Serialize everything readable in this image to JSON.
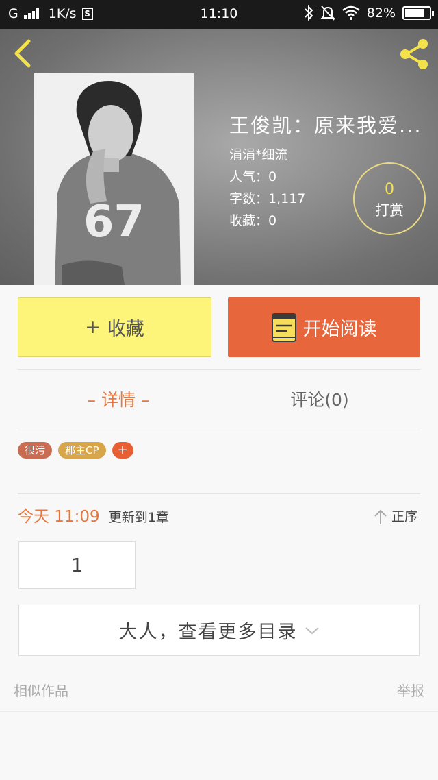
{
  "status_bar": {
    "network": "G",
    "speed": "1K/s",
    "s_label": "S",
    "time": "11:10",
    "battery": "82%",
    "battery_level": 0.82
  },
  "book": {
    "title": "王俊凯：原来我爱...",
    "author": "涓涓*细流",
    "popularity": "人气：0",
    "word_count": "字数：1,117",
    "favorites": "收藏：0"
  },
  "reward": {
    "count": "0",
    "label": "打赏"
  },
  "actions": {
    "collect": "收藏",
    "collect_plus": "+",
    "read": "开始阅读"
  },
  "tabs": {
    "detail": "– 详情 –",
    "comments": "评论(0)"
  },
  "tags": [
    "很污",
    "郡主CP"
  ],
  "tag_add": "+",
  "update": {
    "today": "今天 11:09",
    "text": "更新到1章",
    "order": "正序"
  },
  "chapters": [
    "1"
  ],
  "more_catalog": "大人，查看更多目录",
  "footer": {
    "similar": "相似作品",
    "report": "举报"
  },
  "colors": {
    "accent_orange": "#e8663b",
    "collect_yellow": "#fdf57a",
    "tab_active": "#e8773f",
    "reward_gold": "#f3e25a"
  }
}
